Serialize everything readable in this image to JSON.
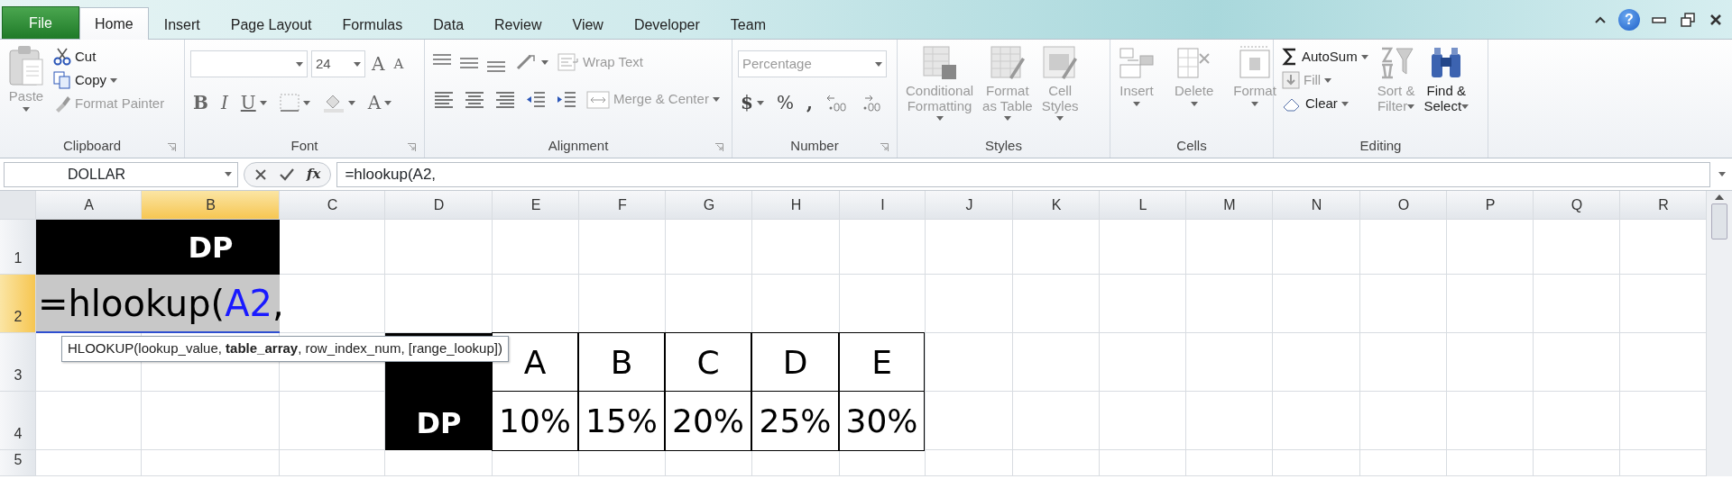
{
  "ribbon_tabs": [
    {
      "label": "File",
      "kind": "file",
      "selected": false
    },
    {
      "label": "Home",
      "kind": "tab",
      "selected": true
    },
    {
      "label": "Insert",
      "kind": "tab",
      "selected": false
    },
    {
      "label": "Page Layout",
      "kind": "tab",
      "selected": false
    },
    {
      "label": "Formulas",
      "kind": "tab",
      "selected": false
    },
    {
      "label": "Data",
      "kind": "tab",
      "selected": false
    },
    {
      "label": "Review",
      "kind": "tab",
      "selected": false
    },
    {
      "label": "View",
      "kind": "tab",
      "selected": false
    },
    {
      "label": "Developer",
      "kind": "tab",
      "selected": false
    },
    {
      "label": "Team",
      "kind": "tab",
      "selected": false
    }
  ],
  "help_button": "?",
  "ribbon": {
    "clipboard": {
      "label": "Clipboard",
      "paste": {
        "label": "Paste",
        "disabled": true
      },
      "cut": {
        "label": "Cut",
        "disabled": false
      },
      "copy": {
        "label": "Copy",
        "disabled": false
      },
      "format_painter": {
        "label": "Format Painter",
        "disabled": true
      }
    },
    "font": {
      "label": "Font",
      "font_size": "24",
      "grow": "A",
      "shrink": "A",
      "bold": "B",
      "italic": "I",
      "underline": "U",
      "font_color": "A"
    },
    "alignment": {
      "label": "Alignment",
      "wrap_text": {
        "label": "Wrap Text",
        "disabled": true
      },
      "merge_center": {
        "label": "Merge & Center",
        "disabled": true
      }
    },
    "number": {
      "label": "Number",
      "format": "Percentage",
      "currency": "$",
      "percent": "%",
      "comma": ","
    },
    "styles": {
      "label": "Styles",
      "buttons": [
        {
          "lines": [
            "Conditional",
            "Formatting"
          ],
          "disabled": true
        },
        {
          "lines": [
            "Format",
            "as Table"
          ],
          "disabled": true
        },
        {
          "lines": [
            "Cell",
            "Styles"
          ],
          "disabled": true
        }
      ]
    },
    "cells": {
      "label": "Cells",
      "buttons": [
        {
          "lines": [
            "Insert"
          ],
          "disabled": true
        },
        {
          "lines": [
            "Delete"
          ],
          "disabled": true
        },
        {
          "lines": [
            "Format"
          ],
          "disabled": true
        }
      ]
    },
    "editing": {
      "label": "Editing",
      "autosum": {
        "label": "AutoSum",
        "disabled": false
      },
      "fill": {
        "label": "Fill",
        "disabled": true
      },
      "clear": {
        "label": "Clear",
        "disabled": false
      },
      "sort_filter": {
        "lines": [
          "Sort &",
          "Filter"
        ],
        "disabled": true
      },
      "find_select": {
        "lines": [
          "Find &",
          "Select"
        ],
        "disabled": false
      }
    }
  },
  "formula_bar": {
    "name_box": "DOLLAR",
    "fx": "fx",
    "formula": "=hlookup(A2,"
  },
  "columns": [
    {
      "label": "A",
      "selected": false
    },
    {
      "label": "B",
      "selected": true
    },
    {
      "label": "C",
      "selected": false
    },
    {
      "label": "D",
      "selected": false
    },
    {
      "label": "E",
      "selected": false
    },
    {
      "label": "F",
      "selected": false
    },
    {
      "label": "G",
      "selected": false
    },
    {
      "label": "H",
      "selected": false
    },
    {
      "label": "I",
      "selected": false
    },
    {
      "label": "J",
      "selected": false
    },
    {
      "label": "K",
      "selected": false
    },
    {
      "label": "L",
      "selected": false
    },
    {
      "label": "M",
      "selected": false
    },
    {
      "label": "N",
      "selected": false
    },
    {
      "label": "O",
      "selected": false
    },
    {
      "label": "P",
      "selected": false
    },
    {
      "label": "Q",
      "selected": false
    },
    {
      "label": "R",
      "selected": false
    }
  ],
  "rows": [
    {
      "label": "1",
      "selected": false,
      "cells": [
        {
          "kind": "dark"
        },
        {
          "kind": "dark",
          "text": "DP"
        }
      ]
    },
    {
      "label": "2",
      "selected": true,
      "cells": [
        {
          "kind": "editing",
          "parts": [
            {
              "text": "=hlookup(",
              "reference": false
            },
            {
              "text": "A2",
              "reference": true
            },
            {
              "text": ",",
              "reference": false
            }
          ]
        }
      ]
    },
    {
      "label": "3",
      "selected": false,
      "cells": [
        {
          "kind": "empty"
        },
        {
          "kind": "empty"
        },
        {
          "kind": "empty"
        },
        {
          "kind": "dark"
        },
        {
          "kind": "table",
          "text": "A"
        },
        {
          "kind": "table",
          "text": "B"
        },
        {
          "kind": "table",
          "text": "C"
        },
        {
          "kind": "table",
          "text": "D"
        },
        {
          "kind": "table",
          "text": "E"
        }
      ]
    },
    {
      "label": "4",
      "selected": false,
      "cells": [
        {
          "kind": "empty"
        },
        {
          "kind": "empty"
        },
        {
          "kind": "empty"
        },
        {
          "kind": "dark",
          "text": "DP"
        },
        {
          "kind": "table",
          "text": "10%"
        },
        {
          "kind": "table",
          "text": "15%"
        },
        {
          "kind": "table",
          "text": "20%"
        },
        {
          "kind": "table",
          "text": "25%"
        },
        {
          "kind": "table",
          "text": "30%"
        }
      ]
    },
    {
      "label": "5",
      "selected": false,
      "cells": []
    }
  ],
  "tooltip": "HLOOKUP(lookup_value, **table_array**, row_index_num, [range_lookup])"
}
